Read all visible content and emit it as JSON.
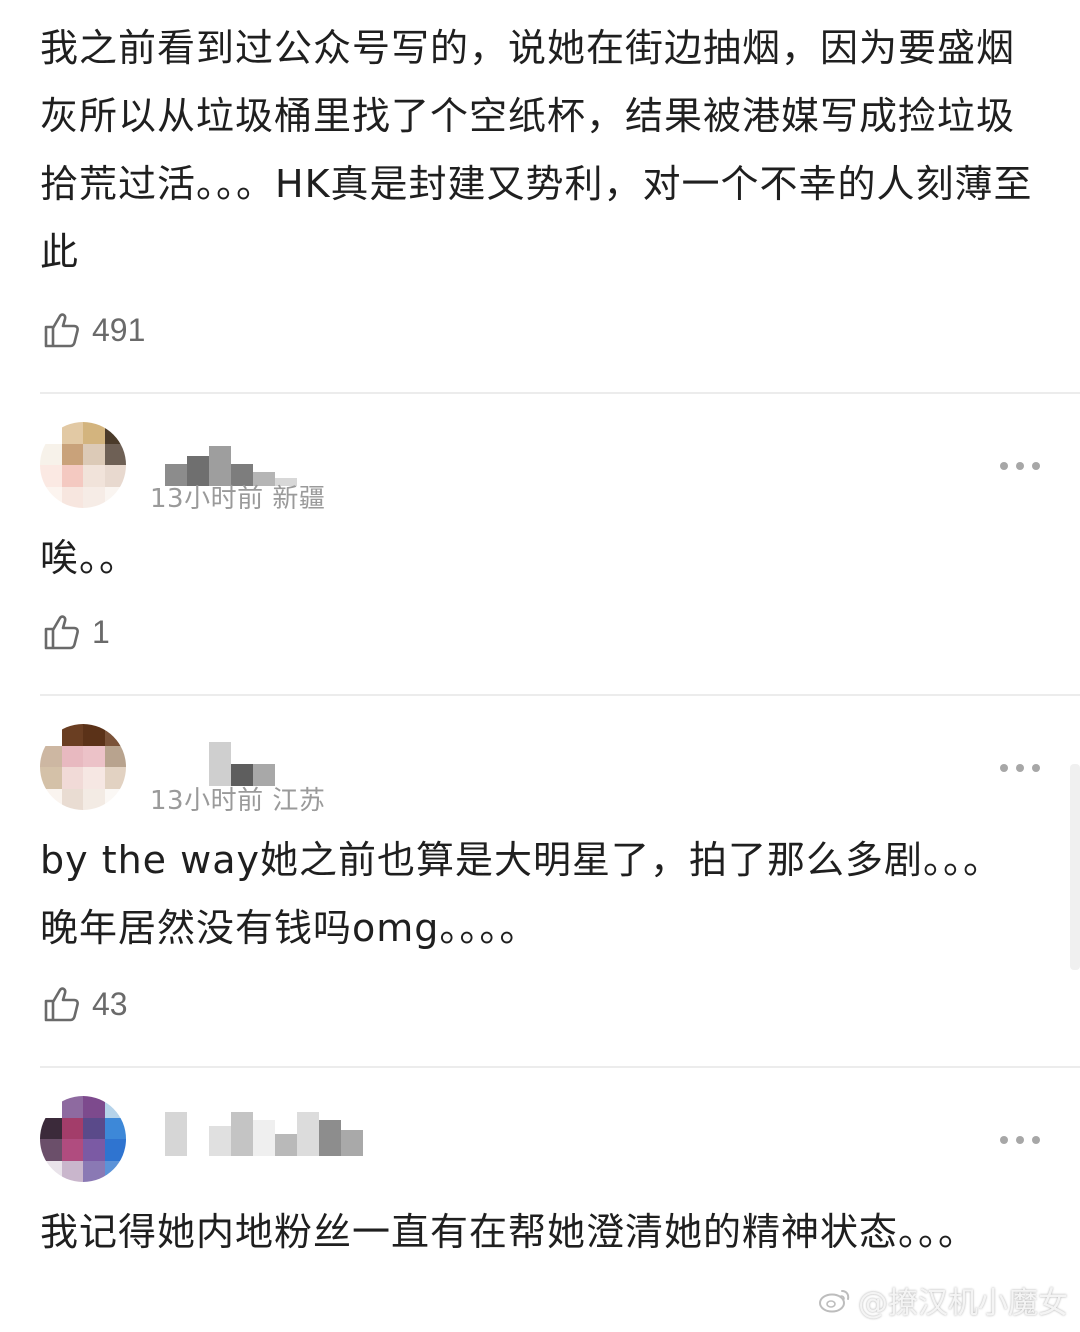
{
  "comments": [
    {
      "text": "我之前看到过公众号写的，说她在街边抽烟，因为要盛烟灰所以从垃圾桶里找了个空纸杯，结果被港媒写成捡垃圾拾荒过活。。。HK真是封建又势利，对一个不幸的人刻薄至此",
      "likes": "491"
    },
    {
      "time_location": "13小时前 新疆",
      "text": "唉。。",
      "likes": "1"
    },
    {
      "time_location": "13小时前 江苏",
      "text": "by the way她之前也算是大明星了，拍了那么多剧。。。晚年居然没有钱吗omg。。。。",
      "likes": "43"
    },
    {
      "text": "我记得她内地粉丝一直有在帮她澄清她的精神状态。。。"
    }
  ],
  "watermark": "@撩汉机小魔女",
  "icons": {
    "like": "thumbs-up-icon",
    "more": "more-dots-icon",
    "weibo": "weibo-logo-icon"
  },
  "colors": {
    "text": "#1f1f1f",
    "meta": "#9a9a9a",
    "divider": "#ececec",
    "icon": "#6a6a6a"
  }
}
